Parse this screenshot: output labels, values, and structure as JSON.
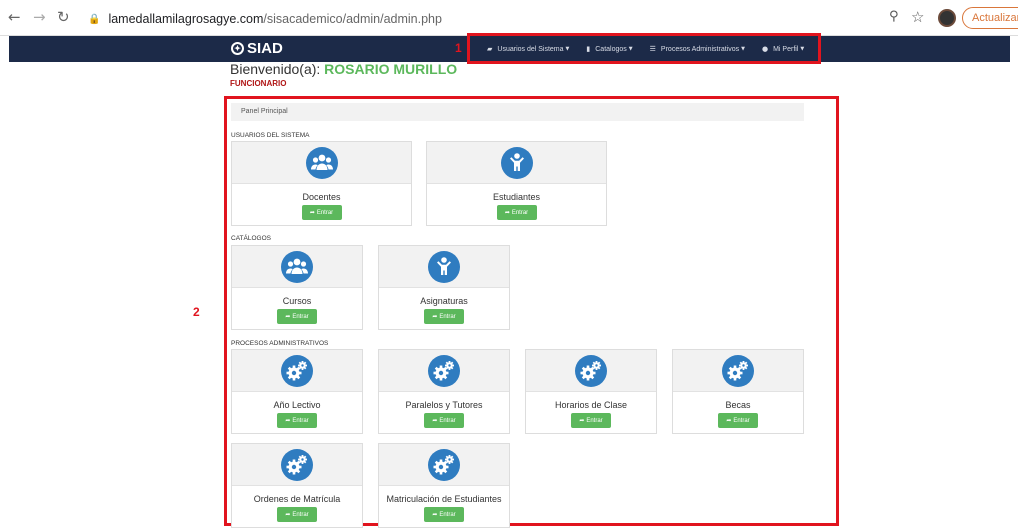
{
  "browser": {
    "url_host": "lamedallamilagrosagye.com",
    "url_path": "/sisacademico/admin/admin.php",
    "update_label": "Actualizar"
  },
  "navbar": {
    "brand": "SIAD",
    "menu": [
      {
        "label": "Usuarios del Sistema",
        "icon": "briefcase-icon"
      },
      {
        "label": "Catalogos",
        "icon": "file-icon"
      },
      {
        "label": "Procesos Administrativos",
        "icon": "list-icon"
      },
      {
        "label": "Mi Perfil",
        "icon": "user-icon"
      }
    ]
  },
  "annotations": {
    "one": "1",
    "two": "2"
  },
  "welcome": {
    "prefix": "Bienvenido(a): ",
    "name": "ROSARIO MURILLO",
    "role": "FUNCIONARIO"
  },
  "panel": {
    "title": "Panel Principal"
  },
  "sections": {
    "usuarios": {
      "title": "USUARIOS DEL SISTEMA",
      "cards": [
        {
          "label": "Docentes",
          "button": "Entrar",
          "icon": "group-icon"
        },
        {
          "label": "Estudiantes",
          "button": "Entrar",
          "icon": "child-icon"
        }
      ]
    },
    "catalogos": {
      "title": "CATÁLOGOS",
      "cards": [
        {
          "label": "Cursos",
          "button": "Entrar",
          "icon": "group-icon"
        },
        {
          "label": "Asignaturas",
          "button": "Entrar",
          "icon": "child-icon"
        }
      ]
    },
    "procesos": {
      "title": "PROCESOS ADMINISTRATIVOS",
      "cards": [
        {
          "label": "Año Lectivo",
          "button": "Entrar",
          "icon": "gears-icon"
        },
        {
          "label": "Paralelos y Tutores",
          "button": "Entrar",
          "icon": "gears-icon"
        },
        {
          "label": "Horarios de Clase",
          "button": "Entrar",
          "icon": "gears-icon"
        },
        {
          "label": "Becas",
          "button": "Entrar",
          "icon": "gears-icon"
        },
        {
          "label": "Ordenes de Matrícula",
          "button": "Entrar",
          "icon": "gears-icon"
        },
        {
          "label": "Matriculación de Estudiantes",
          "button": "Entrar",
          "icon": "gears-icon"
        }
      ]
    }
  }
}
